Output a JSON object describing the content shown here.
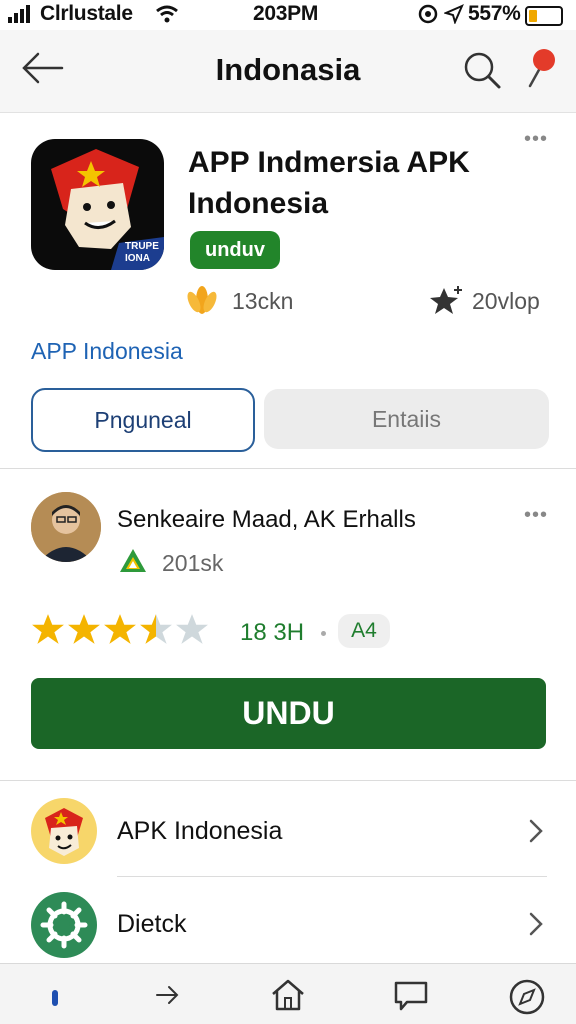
{
  "status_bar": {
    "carrier": "Clrlustale",
    "time": "203PM",
    "battery_pct": "557%"
  },
  "header": {
    "title": "Indonasia",
    "back_icon": "arrow-left-icon",
    "search_icon": "search-icon",
    "pin_icon": "map-pin-icon"
  },
  "app": {
    "name_line1": "APP Indmersia APK",
    "name_line2": "Indonesia",
    "install_pill": "unduv",
    "downloads": "13ckn",
    "rating_count": "20vlop",
    "developer_link": "APP Indonesia",
    "icon_text_line1": "TRUPE",
    "icon_text_line2": "IONA"
  },
  "tabs": {
    "primary": "Pnguneal",
    "secondary": "Entaiis"
  },
  "reviewer": {
    "name": "Senkeaire Maad, AK Erhalls",
    "sub": "201sk",
    "stars": 3.5,
    "stars_max": 5,
    "rating_text": "18 3H",
    "badge": "A4"
  },
  "install_button": "UNDU",
  "list": [
    {
      "label": "APK Indonesia",
      "icon": "app-avatar-icon"
    },
    {
      "label": "Dietck",
      "icon": "settings-gear-icon"
    }
  ],
  "colors": {
    "brand_green": "#1b6627",
    "pill_green": "#22852a",
    "link_blue": "#1e63b4"
  }
}
